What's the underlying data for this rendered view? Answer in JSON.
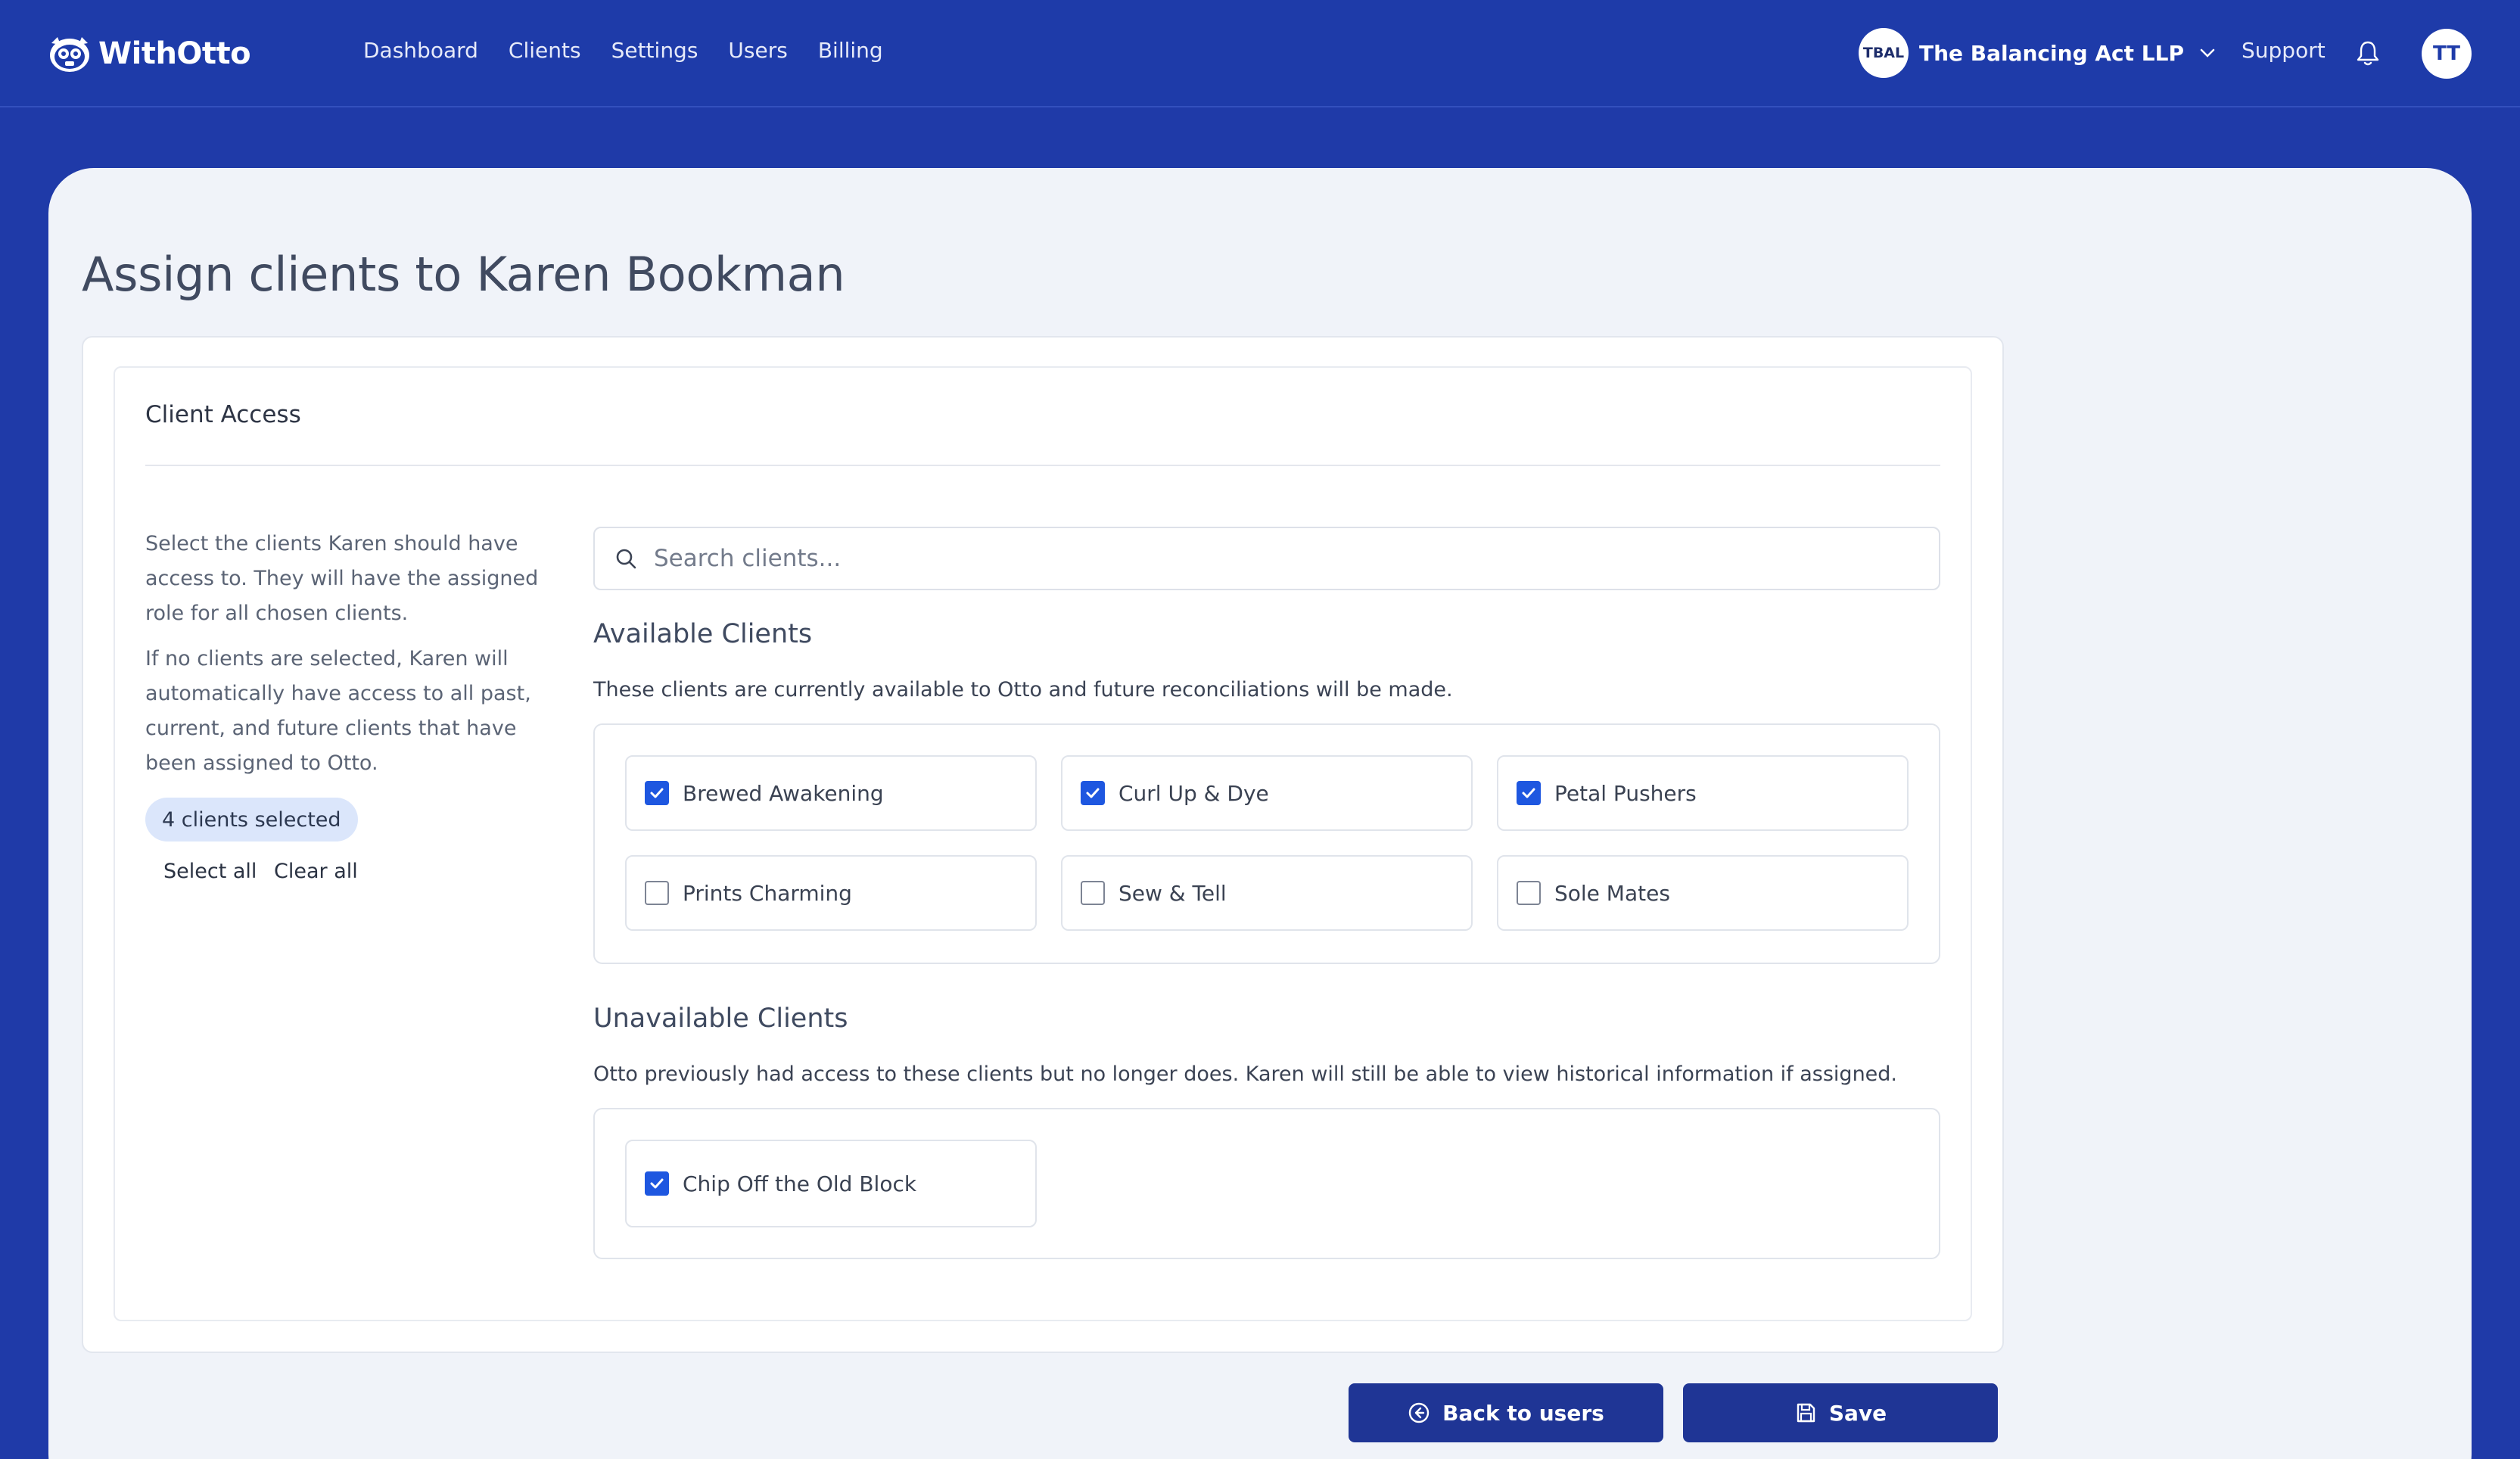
{
  "brand": {
    "name": "WithOtto"
  },
  "nav": {
    "items": [
      "Dashboard",
      "Clients",
      "Settings",
      "Users",
      "Billing"
    ]
  },
  "org": {
    "initials": "TBAL",
    "name": "The Balancing Act LLP"
  },
  "header": {
    "support": "Support",
    "user_initials": "TT"
  },
  "page": {
    "title": "Assign clients to Karen Bookman"
  },
  "access": {
    "section_title": "Client Access",
    "help_1": "Select the clients Karen should have access to. They will have the assigned role for all chosen clients.",
    "help_2": "If no clients are selected, Karen will automatically have access to all past, current, and future clients that have been assigned to Otto.",
    "selected_count": "4 clients selected",
    "select_all": "Select all",
    "clear_all": "Clear all",
    "search_placeholder": "Search clients..."
  },
  "available": {
    "heading": "Available Clients",
    "description": "These clients are currently available to Otto and future reconciliations will be made.",
    "clients": [
      {
        "name": "Brewed Awakening",
        "checked": true
      },
      {
        "name": "Curl Up & Dye",
        "checked": true
      },
      {
        "name": "Petal Pushers",
        "checked": true
      },
      {
        "name": "Prints Charming",
        "checked": false
      },
      {
        "name": "Sew & Tell",
        "checked": false
      },
      {
        "name": "Sole Mates",
        "checked": false
      }
    ]
  },
  "unavailable": {
    "heading": "Unavailable Clients",
    "description": "Otto previously had access to these clients but no longer does. Karen will still be able to view historical information if assigned.",
    "clients": [
      {
        "name": "Chip Off the Old Block",
        "checked": true
      }
    ]
  },
  "footer": {
    "back_label": "Back to users",
    "save_label": "Save"
  },
  "colors": {
    "brand_blue": "#1e3ba9",
    "accent": "#1e57e0",
    "button": "#1f3595"
  }
}
